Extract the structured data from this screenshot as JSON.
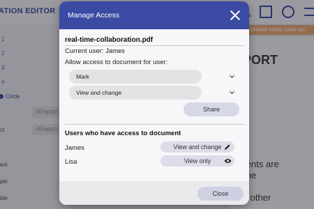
{
  "background": {
    "app_title": "ATION EDITOR",
    "left_numbers": [
      "1",
      "2",
      "3",
      "4"
    ],
    "selected_option": "Circle",
    "empty_placeholder": "<Empty>",
    "left_labels": [
      "ct",
      "ext",
      "ple",
      "ble"
    ],
    "banner": "shared mode (view an",
    "doc_heading": "PORT",
    "doc_lines": [
      "ments are",
      "ume",
      "ss other"
    ]
  },
  "modal": {
    "title": "Manage Access",
    "filename": "real-time-collaboration.pdf",
    "current_user": "Current user: James",
    "allow_label": "Allow access to document for user:",
    "user_select": "Mark",
    "permission_select": "View and change",
    "share_label": "Share",
    "users_heading": "Users who have access to document",
    "users": [
      {
        "name": "James",
        "permission": "View and change",
        "icon": "pencil-icon"
      },
      {
        "name": "Lisa",
        "permission": "View only",
        "icon": "eye-icon"
      }
    ],
    "close_label": "Close"
  },
  "colors": {
    "header": "#3b4ba3",
    "accent": "#2b3c8f",
    "banner": "#e39b63"
  }
}
